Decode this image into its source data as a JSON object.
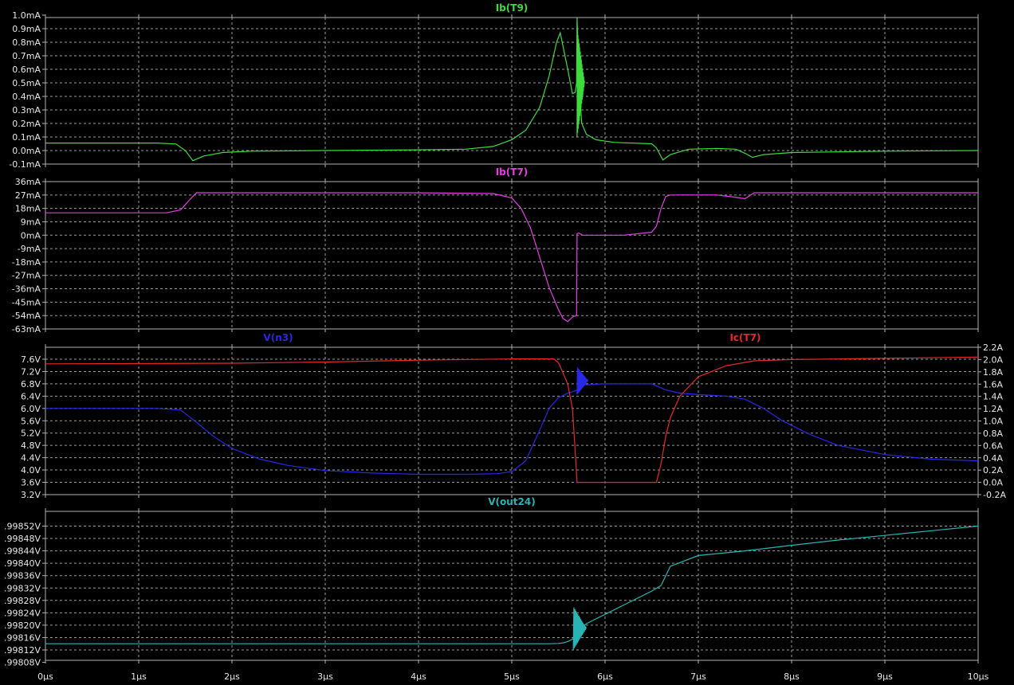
{
  "colors": {
    "background": "#000000",
    "grid": "#9a9a9a",
    "frame": "#b0b0b0",
    "text": "#e6e6e6"
  },
  "chart_data": [
    {
      "type": "line",
      "title": "",
      "x_ticks": [
        "0µs",
        "1µs",
        "2µs",
        "3µs",
        "4µs",
        "5µs",
        "6µs",
        "7µs",
        "8µs",
        "9µs",
        "10µs"
      ],
      "xlim": [
        0,
        10
      ],
      "grid": true,
      "y_left": {
        "ticks": [
          "1.0mA",
          "0.9mA",
          "0.8mA",
          "0.7mA",
          "0.6mA",
          "0.5mA",
          "0.4mA",
          "0.3mA",
          "0.2mA",
          "0.1mA",
          "0.0mA",
          "-0.1mA"
        ],
        "ylim": [
          -0.1,
          1.0
        ]
      },
      "series": [
        {
          "name": "Ib(T9)",
          "axis": "left",
          "color": "#3cdc3c",
          "x": [
            0,
            1.2,
            1.4,
            1.5,
            1.58,
            1.7,
            1.9,
            2.2,
            3,
            4,
            4.5,
            4.8,
            5.0,
            5.15,
            5.3,
            5.4,
            5.48,
            5.52,
            5.6,
            5.65,
            5.68,
            5.695,
            5.7,
            5.72,
            5.75,
            5.8,
            5.9,
            6.1,
            6.5,
            6.55,
            6.62,
            6.7,
            6.9,
            7.2,
            7.4,
            7.5,
            7.58,
            7.7,
            8,
            9,
            10
          ],
          "y": [
            0.055,
            0.055,
            0.048,
            0.0,
            -0.075,
            -0.04,
            -0.015,
            -0.005,
            0.0,
            0.005,
            0.01,
            0.03,
            0.08,
            0.15,
            0.32,
            0.55,
            0.8,
            0.87,
            0.6,
            0.42,
            0.43,
            0.5,
            0.98,
            0.5,
            0.2,
            0.12,
            0.08,
            0.06,
            0.05,
            0.02,
            -0.07,
            -0.03,
            0.01,
            0.015,
            0.01,
            -0.02,
            -0.05,
            -0.03,
            -0.015,
            -0.005,
            0.0
          ],
          "burst": {
            "x0": 5.7,
            "x1": 5.78,
            "lo": 0.1,
            "hi": 0.9
          }
        }
      ]
    },
    {
      "type": "line",
      "title": "",
      "x_ticks": [
        "0µs",
        "1µs",
        "2µs",
        "3µs",
        "4µs",
        "5µs",
        "6µs",
        "7µs",
        "8µs",
        "9µs",
        "10µs"
      ],
      "xlim": [
        0,
        10
      ],
      "grid": true,
      "y_left": {
        "ticks": [
          "36mA",
          "27mA",
          "18mA",
          "9mA",
          "0mA",
          "-9mA",
          "-18mA",
          "-27mA",
          "-36mA",
          "-45mA",
          "-54mA",
          "-63mA"
        ],
        "ylim": [
          -63,
          36
        ]
      },
      "series": [
        {
          "name": "Ib(T7)",
          "axis": "left",
          "color": "#e63ce6",
          "x": [
            0,
            1.3,
            1.45,
            1.55,
            1.62,
            1.7,
            3,
            4,
            4.8,
            5.0,
            5.1,
            5.2,
            5.3,
            5.4,
            5.5,
            5.55,
            5.6,
            5.65,
            5.69,
            5.695,
            5.7,
            5.72,
            5.76,
            6.2,
            6.5,
            6.55,
            6.6,
            6.65,
            6.7,
            7.2,
            7.4,
            7.5,
            7.6,
            7.7,
            8,
            9,
            10
          ],
          "y": [
            15,
            15,
            17,
            24,
            28.5,
            28.5,
            28.5,
            28.5,
            28,
            25,
            18,
            5,
            -15,
            -35,
            -50,
            -56,
            -58,
            -55,
            -54,
            -54,
            1,
            1.5,
            0,
            0,
            2,
            6,
            18,
            26,
            27,
            27,
            25.5,
            24.5,
            28.5,
            28.5,
            28.5,
            28.5,
            28.5
          ]
        }
      ]
    },
    {
      "type": "line",
      "title": "",
      "x_ticks": [
        "0µs",
        "1µs",
        "2µs",
        "3µs",
        "4µs",
        "5µs",
        "6µs",
        "7µs",
        "8µs",
        "9µs",
        "10µs"
      ],
      "xlim": [
        0,
        10
      ],
      "grid": true,
      "y_left": {
        "ticks": [
          "7.6V",
          "7.2V",
          "6.8V",
          "6.4V",
          "6.0V",
          "5.6V",
          "5.2V",
          "4.8V",
          "4.4V",
          "4.0V",
          "3.6V",
          "3.2V"
        ],
        "ylim": [
          3.2,
          7.8
        ]
      },
      "y_right": {
        "ticks": [
          "2.2A",
          "2.0A",
          "1.8A",
          "1.6A",
          "1.4A",
          "1.2A",
          "1.0A",
          "0.8A",
          "0.6A",
          "0.4A",
          "0.2A",
          "0.0A",
          "-0.2A"
        ],
        "ylim": [
          -0.2,
          2.2
        ]
      },
      "series": [
        {
          "name": "V(n3)",
          "axis": "left",
          "color": "#2828e6",
          "x": [
            0,
            1.2,
            1.45,
            1.6,
            1.8,
            2.0,
            2.3,
            2.6,
            3.0,
            3.5,
            4.0,
            4.5,
            4.85,
            5.0,
            5.15,
            5.3,
            5.4,
            5.5,
            5.6,
            5.66,
            5.7,
            5.72,
            5.8,
            6.0,
            6.3,
            6.5,
            6.65,
            6.8,
            7.0,
            7.3,
            7.5,
            7.7,
            7.9,
            8.2,
            8.5,
            9.0,
            9.5,
            10
          ],
          "y": [
            6.0,
            6.0,
            5.95,
            5.6,
            5.1,
            4.7,
            4.35,
            4.15,
            3.98,
            3.9,
            3.86,
            3.86,
            3.88,
            3.95,
            4.3,
            5.3,
            6.0,
            6.35,
            6.5,
            6.55,
            6.6,
            6.75,
            6.77,
            6.8,
            6.8,
            6.8,
            6.6,
            6.5,
            6.45,
            6.4,
            6.3,
            6.0,
            5.6,
            5.15,
            4.8,
            4.5,
            4.35,
            4.3
          ],
          "burst": {
            "x0": 5.7,
            "x1": 5.82,
            "lo": 6.45,
            "hi": 7.35
          }
        },
        {
          "name": "Ic(T7)",
          "axis": "right",
          "color": "#e62828",
          "x": [
            0,
            2,
            3,
            4,
            5,
            5.45,
            5.5,
            5.55,
            5.6,
            5.65,
            5.68,
            5.7,
            6.55,
            6.6,
            6.65,
            6.7,
            6.8,
            7.0,
            7.3,
            7.6,
            8,
            9,
            10
          ],
          "y": [
            1.93,
            1.94,
            1.96,
            1.99,
            2.01,
            2.01,
            1.95,
            1.78,
            1.6,
            1.2,
            0.5,
            0.0,
            0.0,
            0.3,
            0.75,
            1.05,
            1.4,
            1.72,
            1.9,
            1.98,
            2.0,
            2.02,
            2.04
          ]
        }
      ]
    },
    {
      "type": "line",
      "title": "",
      "x_ticks": [
        "0µs",
        "1µs",
        "2µs",
        "3µs",
        "4µs",
        "5µs",
        "6µs",
        "7µs",
        "8µs",
        "9µs",
        "10µs"
      ],
      "xlim": [
        0,
        10
      ],
      "grid": true,
      "y_left": {
        "ticks": [
          ".99852V",
          ".99848V",
          ".99844V",
          ".99840V",
          ".99836V",
          ".99832V",
          ".99828V",
          ".99824V",
          ".99820V",
          ".99816V",
          ".99812V",
          ".99808V"
        ],
        "ylim": [
          0.99808,
          0.99854
        ]
      },
      "series": [
        {
          "name": "V(out24)",
          "axis": "left",
          "color": "#28b4b4",
          "x": [
            0,
            1,
            2,
            3,
            4,
            5,
            5.4,
            5.5,
            5.55,
            5.6,
            5.62,
            5.65,
            5.68,
            5.72,
            5.8,
            5.9,
            6.0,
            6.2,
            6.4,
            6.5,
            6.6,
            6.7,
            7.0,
            7.5,
            8,
            8.5,
            9,
            9.5,
            10
          ],
          "y": [
            0.99814,
            0.99814,
            0.99814,
            0.99814,
            0.99814,
            0.99814,
            0.99814,
            0.998141,
            0.998143,
            0.998147,
            0.99815,
            0.998155,
            0.998165,
            0.998185,
            0.998205,
            0.99822,
            0.998235,
            0.998265,
            0.998295,
            0.99831,
            0.998328,
            0.99839,
            0.998425,
            0.99844,
            0.998458,
            0.998475,
            0.99849,
            0.998505,
            0.99852
          ],
          "burst": {
            "x0": 5.66,
            "x1": 5.8,
            "lo": 0.99812,
            "hi": 0.99826
          }
        }
      ]
    }
  ]
}
